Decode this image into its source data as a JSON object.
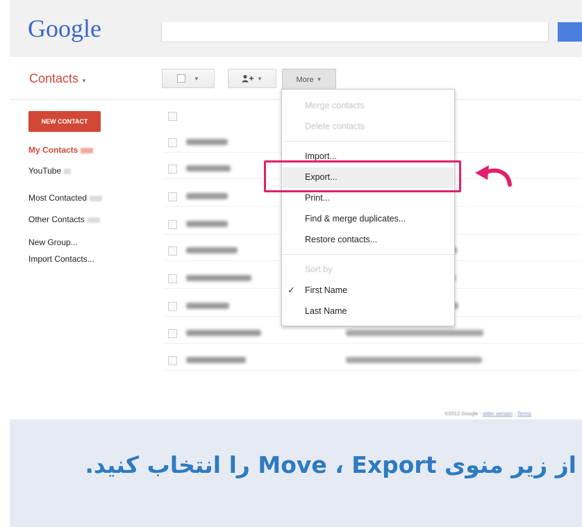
{
  "header": {
    "logo_text": "Google"
  },
  "toolbar": {
    "contacts_label": "Contacts",
    "more_label": "More",
    "add_icon": "person-add-icon"
  },
  "sidebar": {
    "new_contact_label": "NEW CONTACT",
    "items": [
      {
        "label": "My Contacts"
      },
      {
        "label": "YouTube"
      },
      {
        "label": "Most Contacted"
      },
      {
        "label": "Other Contacts"
      },
      {
        "label": "New Group..."
      },
      {
        "label": "Import Contacts..."
      }
    ]
  },
  "menu": {
    "merge": "Merge contacts",
    "delete": "Delete contacts",
    "import": "Import...",
    "export": "Export...",
    "print": "Print...",
    "find_merge": "Find & merge duplicates...",
    "restore": "Restore contacts...",
    "sort_by": "Sort by",
    "first_name": "First Name",
    "last_name": "Last Name"
  },
  "footer": {
    "copyright": "©2012 Google",
    "older_version": "older version",
    "terms": "Terms"
  },
  "caption": {
    "text": "از زیر منوی Move ، Export را انتخاب کنید."
  },
  "colors": {
    "accent_red": "#d14836",
    "highlight_pink": "#e0206b",
    "caption_blue": "#2e7bc0",
    "google_blue": "#3b67c9"
  }
}
